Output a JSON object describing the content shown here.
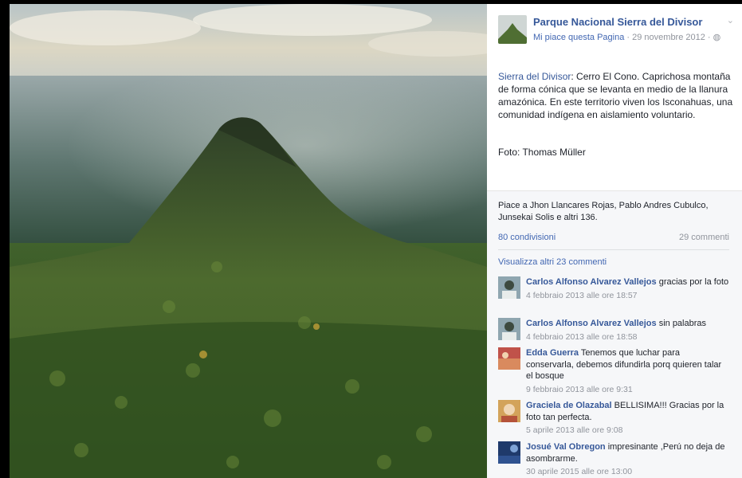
{
  "page": {
    "name": "Parque Nacional Sierra del Divisor",
    "like_label": "Mi piace questa Pagina",
    "date": " · 29 novembre 2012 · ",
    "privacy_icon": "globe-icon"
  },
  "post": {
    "link_text": "Sierra del Divisor",
    "body": ": Cerro El Cono. Caprichosa montaña de forma cónica que se levanta en medio de la llanura amazónica. En este territorio viven los Isconahuas, una comunidad indígena en aislamiento voluntario.",
    "credit": "Foto: Thomas Müller"
  },
  "engagement": {
    "likes_text": "Piace a Jhon Llancares Rojas, Pablo Andres Cubulco, Junsekai Solis e altri 136.",
    "shares": "80 condivisioni",
    "comments_count": "29 commenti",
    "view_more": "Visualizza altri 23 commenti"
  },
  "comments": [
    {
      "author": "Carlos Alfonso Alvarez Vallejos",
      "text": " gracias por la foto",
      "date": "4 febbraio 2013 alle ore 18:57"
    },
    {
      "author": "Carlos Alfonso Alvarez Vallejos",
      "text": " sin palabras",
      "date": "4 febbraio 2013 alle ore 18:58"
    },
    {
      "author": "Edda Guerra",
      "text": " Tenemos que luchar para conservarla, debemos difundirla porq quieren talar el bosque",
      "date": "9 febbraio 2013 alle ore 9:31"
    },
    {
      "author": "Graciela de Olazabal",
      "text": " BELLISIMA!!! Gracias por la foto tan perfecta.",
      "date": "5 aprile 2013 alle ore 9:08"
    },
    {
      "author": "Josué Val Obregon",
      "text": " impresinante ,Perú no deja de asombrarme.",
      "date": "30 aprile 2015 alle ore 13:00"
    }
  ],
  "colors": {
    "link": "#365899",
    "muted": "#90949c",
    "panel_bg": "#f6f7f9"
  }
}
